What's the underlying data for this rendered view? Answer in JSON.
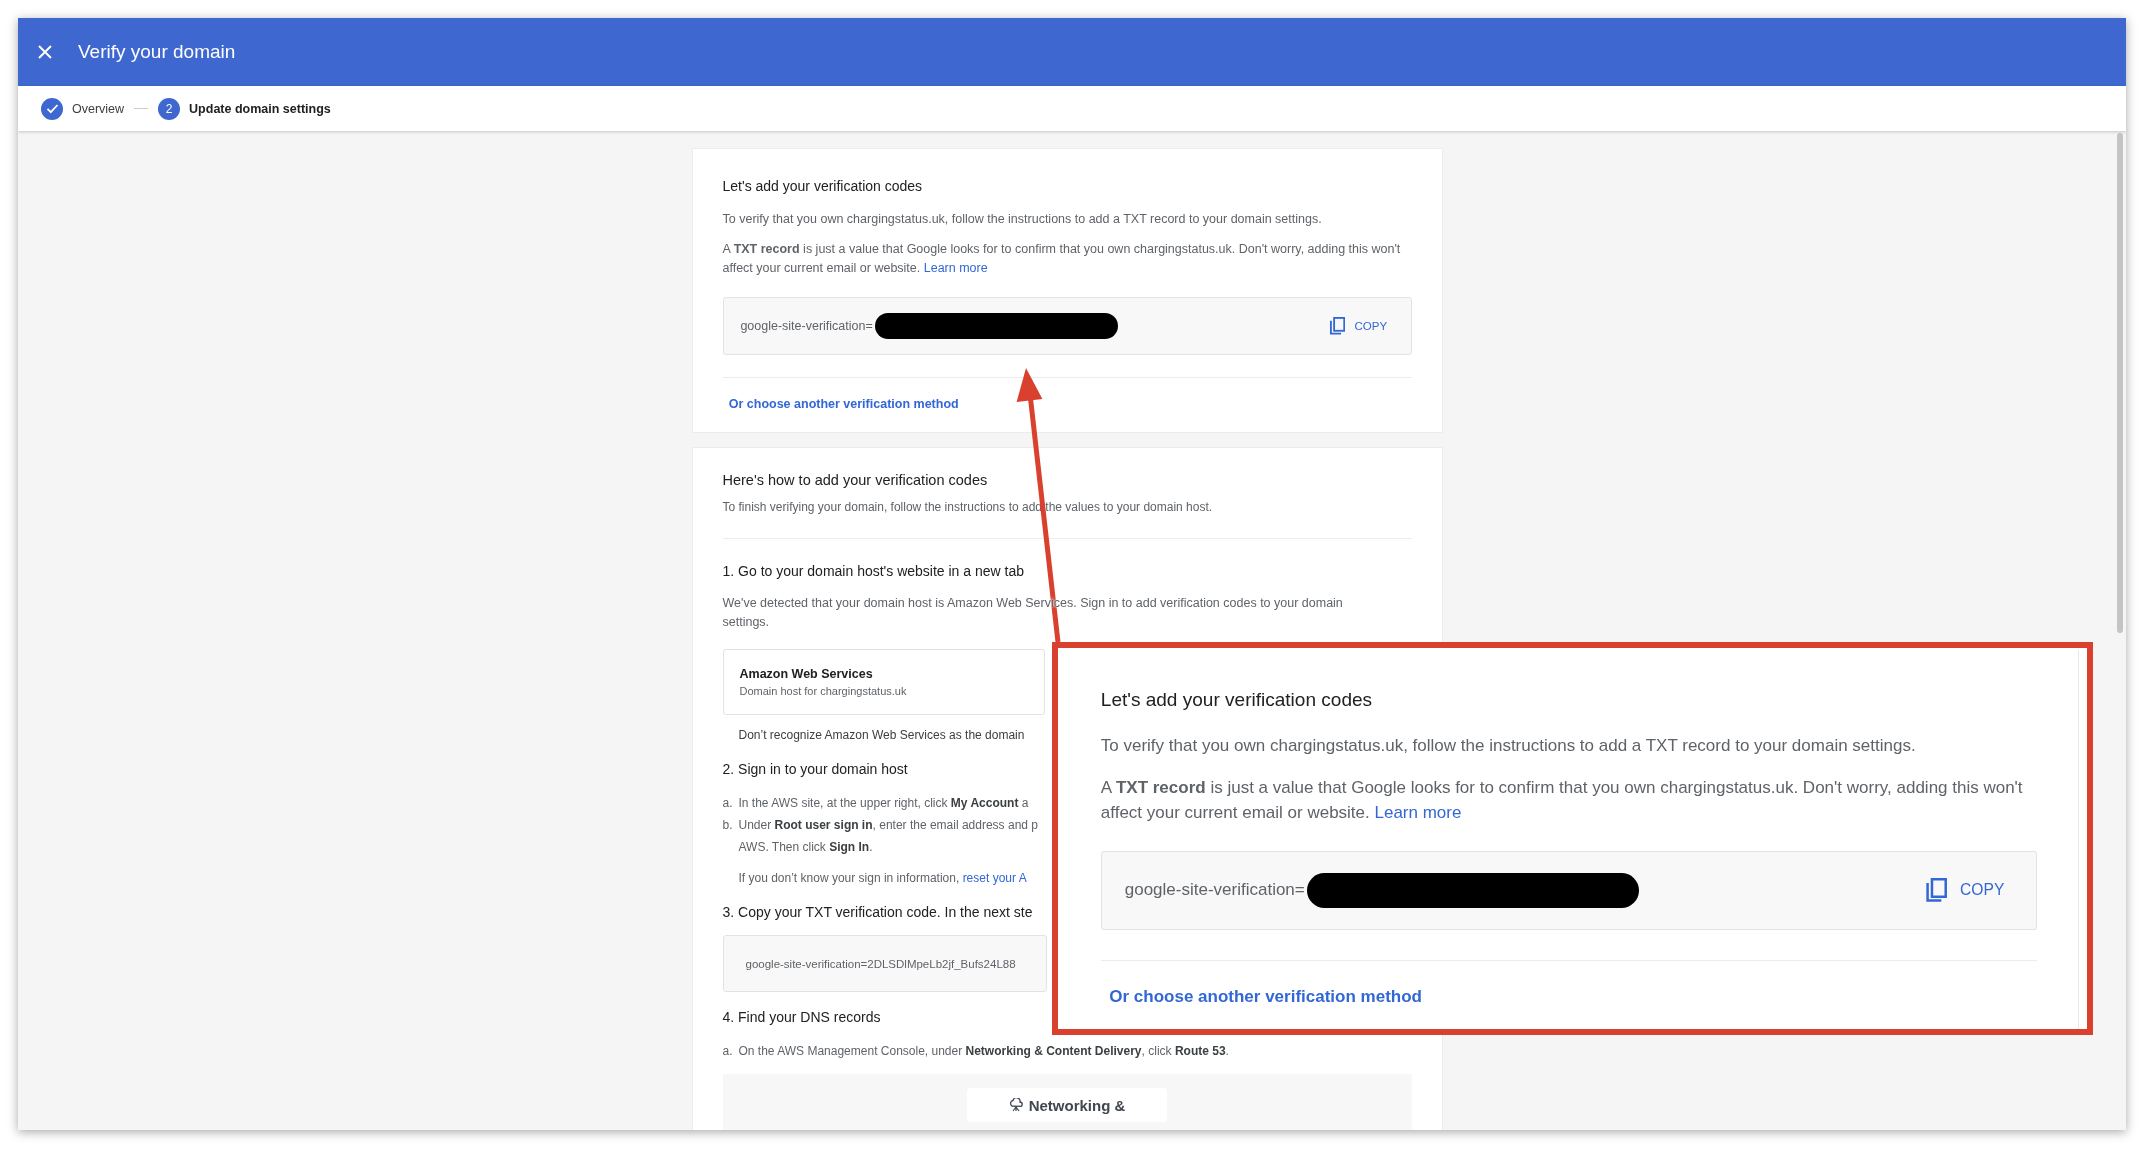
{
  "window": {
    "title": "Verify your domain"
  },
  "steps": [
    {
      "label": "Overview",
      "done": true,
      "selected": false
    },
    {
      "number": "2",
      "label": "Update domain settings",
      "done": false,
      "selected": true
    }
  ],
  "verification_card": {
    "title": "Let's add your verification codes",
    "intro": "To verify that you own chargingstatus.uk, follow the instructions to add a TXT record to your domain settings.",
    "explanation": "A **TXT record** is just a value that Google looks for to confirm that you own chargingstatus.uk. Don't worry, adding this won't affect your current email or website.",
    "learn_more": "Learn more",
    "code": "google-site-verification=",
    "code_redacted": true,
    "copy_button": "COPY",
    "alt_method_link": "Or choose another verification method"
  },
  "instructions_card": {
    "title": "Here's how to add your verification codes",
    "intro": "To finish verifying your domain, follow the instructions to add the values to your domain host.",
    "steps": [
      {
        "heading": "1. Go to your domain host's website in a new tab",
        "blocks": [
          {
            "kind": "paragraph",
            "text": "We've detected that your domain host is Amazon Web Services. Sign in to add verification codes to your domain settings."
          },
          {
            "kind": "host",
            "name": "Amazon Web Services",
            "detail": "Domain host for chargingstatus.uk"
          },
          {
            "kind": "note",
            "text": "Don’t recognize Amazon Web Services as the domain"
          }
        ]
      },
      {
        "heading": "2. Sign in to your domain host",
        "blocks": [
          {
            "kind": "item",
            "marker": "a.",
            "lines": [
              "In the AWS site, at the upper right, click **My Account** a"
            ]
          },
          {
            "kind": "item",
            "marker": "b.",
            "lines": [
              "Under **Root user sign in**, enter the email address and p",
              "AWS. Then click **Sign In**."
            ]
          },
          {
            "kind": "note",
            "text": "If you don’t know your sign in information, ",
            "link": "reset your A"
          }
        ]
      },
      {
        "heading": "3. Copy your TXT verification code. In the next ste",
        "blocks": [
          {
            "kind": "code",
            "text": "google-site-verification=2DLSDlMpeLb2jf_Bufs24L88"
          }
        ]
      },
      {
        "heading": "4. Find your DNS records",
        "blocks": [
          {
            "kind": "item",
            "marker": "a.",
            "lines": [
              "On the AWS Management Console, under **Networking & Content Delivery**, click **Route 53**."
            ]
          },
          {
            "kind": "screenshot",
            "label": "Networking &"
          }
        ]
      }
    ]
  },
  "zoomed_callout": {
    "title": "Let's add your verification codes",
    "intro": "To verify that you own chargingstatus.uk, follow the instructions to add a TXT record to your domain settings.",
    "explanation": "A **TXT record** is just a value that Google looks for to confirm that you own chargingstatus.uk. Don't worry, adding this won't affect your current email or website.",
    "learn_more": "Learn more",
    "code": "google-site-verification=",
    "code_redacted": true,
    "copy_button": "COPY",
    "alt_method_link": "Or choose another verification method"
  }
}
